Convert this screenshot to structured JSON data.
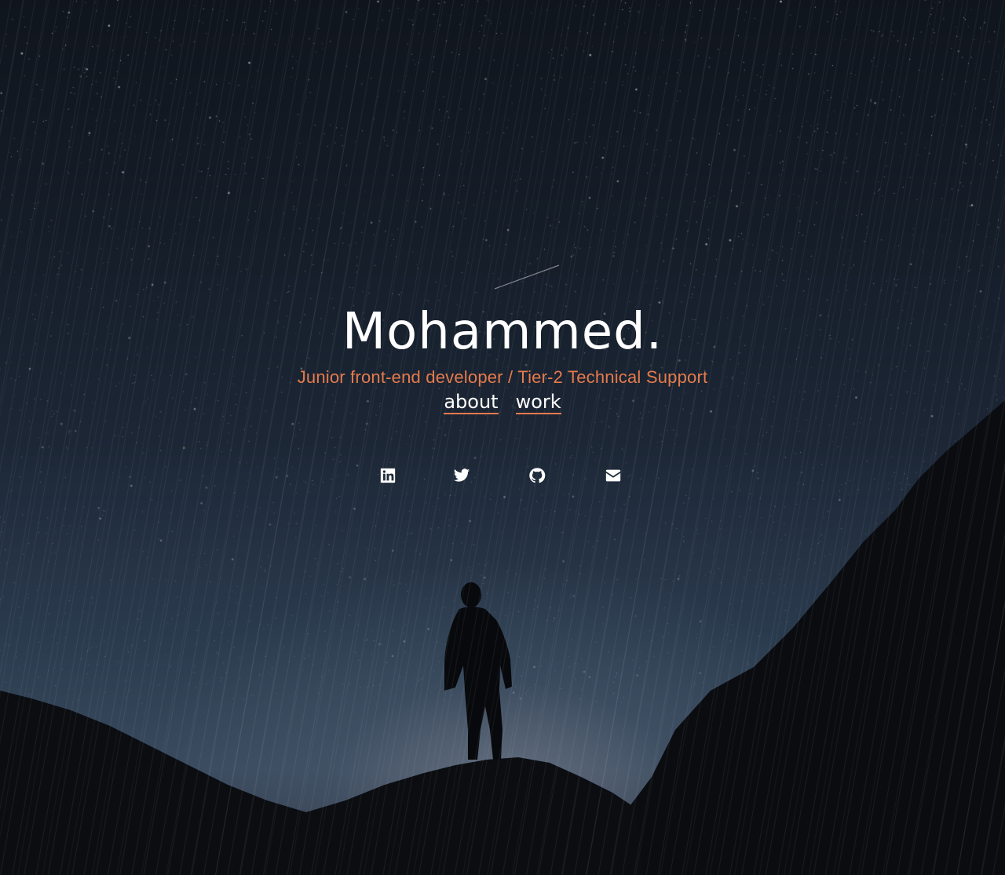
{
  "hero": {
    "name": "Mohammed.",
    "subtitle": "Junior front-end developer / Tier-2 Technical Support"
  },
  "nav": {
    "about": "about",
    "work": "work"
  },
  "social": [
    {
      "icon": "linkedin-icon"
    },
    {
      "icon": "twitter-icon"
    },
    {
      "icon": "github-icon"
    },
    {
      "icon": "envelope-icon"
    }
  ],
  "colors": {
    "accent": "#e57b4d",
    "text": "#ffffff",
    "sky_top": "#10151d",
    "sky_horizon": "#3a4a5e"
  }
}
